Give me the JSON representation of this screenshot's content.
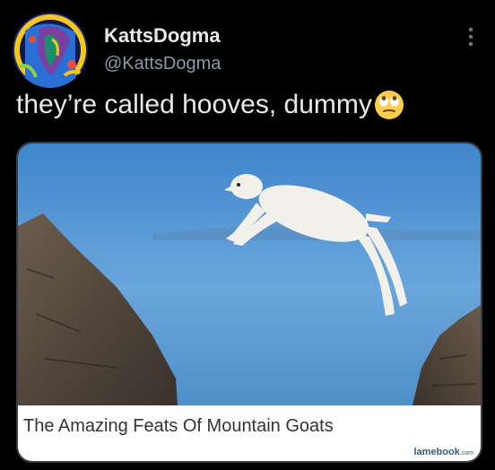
{
  "author": {
    "display_name": "KattsDogma",
    "handle": "@KattsDogma"
  },
  "tweet": {
    "text": "they’re called hooves, dummy",
    "emoji": "face-with-rolling-eyes"
  },
  "card": {
    "title": "The Amazing Feats Of Mountain Goats",
    "source_main": "lamebook",
    "source_suffix": ".com"
  },
  "icons": {
    "more": "more-options-icon",
    "avatar": "avatar-artwork"
  },
  "colors": {
    "background": "#000000",
    "name_text": "#e7e9ea",
    "handle_text": "#8b98a5",
    "card_border": "#3a3d41",
    "card_footer": "#ffffff"
  }
}
